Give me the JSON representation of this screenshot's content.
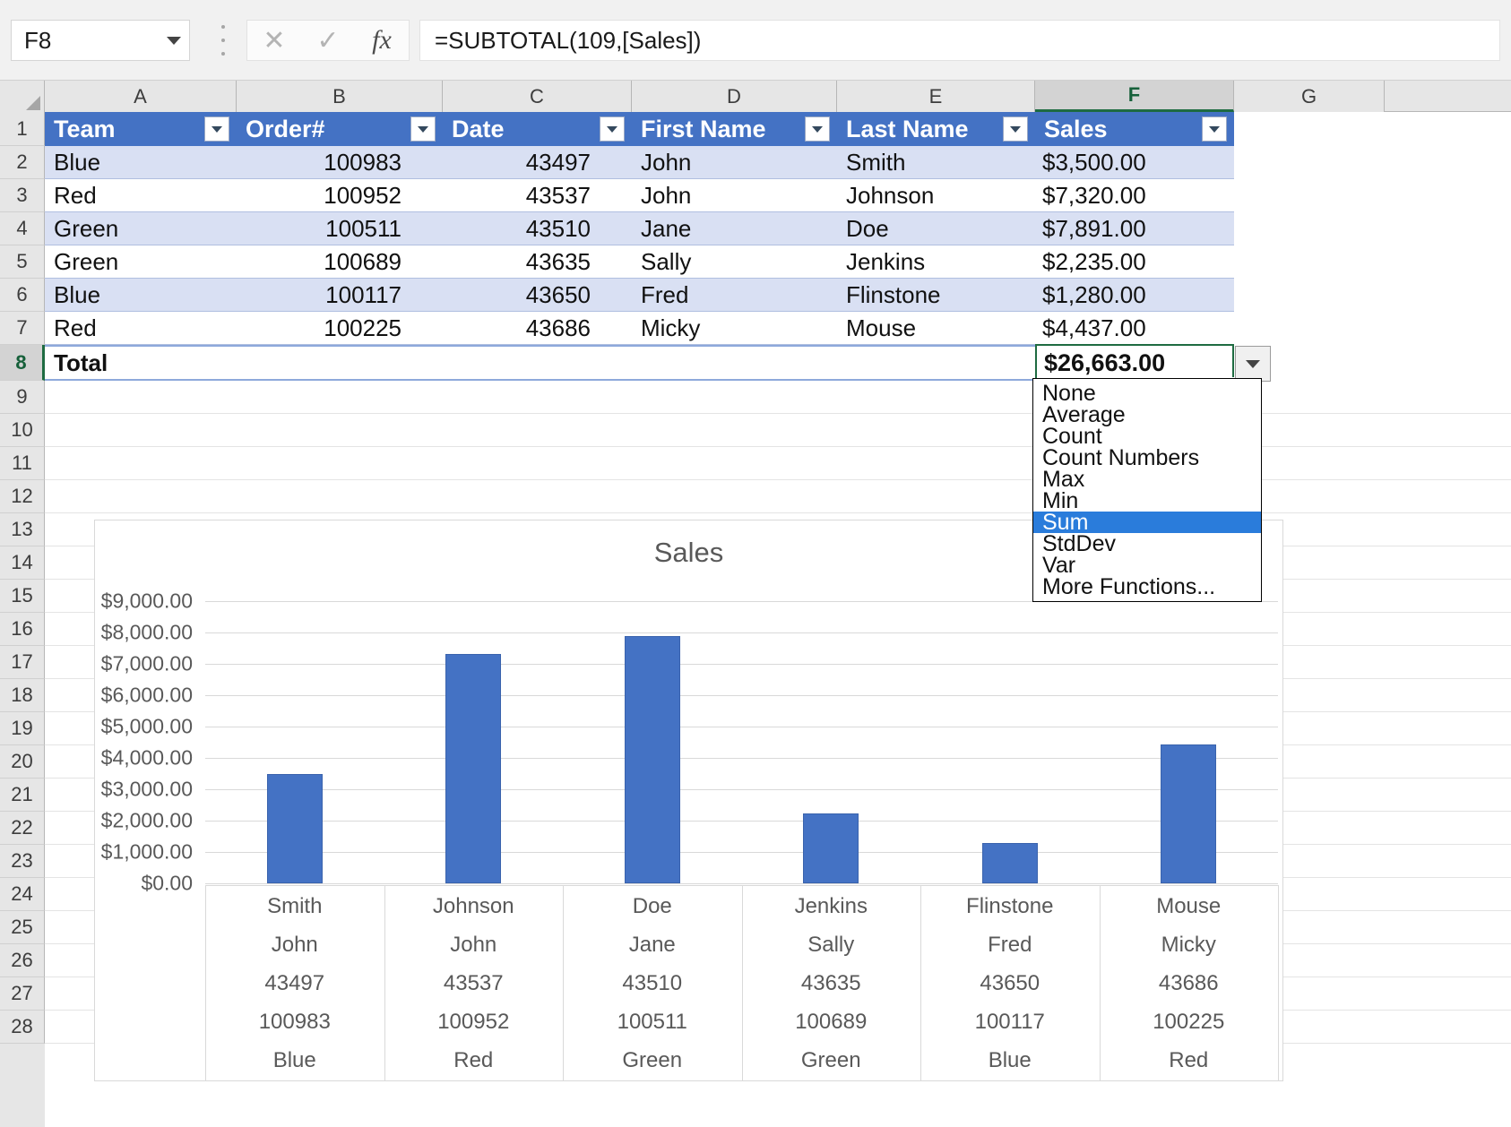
{
  "formula_bar": {
    "name_box_value": "F8",
    "formula": "=SUBTOTAL(109,[Sales])",
    "cancel_icon": "✕",
    "enter_icon": "✓",
    "function_icon": "fx"
  },
  "columns": [
    "A",
    "B",
    "C",
    "D",
    "E",
    "F",
    "G"
  ],
  "selected_column": "F",
  "selected_row": "8",
  "row_numbers": [
    "1",
    "2",
    "3",
    "4",
    "5",
    "6",
    "7",
    "8",
    "9",
    "10",
    "11",
    "12",
    "13",
    "14",
    "15",
    "16",
    "17",
    "18",
    "19",
    "20",
    "21",
    "22",
    "23",
    "24",
    "25",
    "26",
    "27",
    "28"
  ],
  "table": {
    "headers": [
      "Team",
      "Order#",
      "Date",
      "First Name",
      "Last Name",
      "Sales"
    ],
    "rows": [
      {
        "team": "Blue",
        "order": "100983",
        "date": "43497",
        "first": "John",
        "last": "Smith",
        "sales": "$3,500.00"
      },
      {
        "team": "Red",
        "order": "100952",
        "date": "43537",
        "first": "John",
        "last": "Johnson",
        "sales": "$7,320.00"
      },
      {
        "team": "Green",
        "order": "100511",
        "date": "43510",
        "first": "Jane",
        "last": "Doe",
        "sales": "$7,891.00"
      },
      {
        "team": "Green",
        "order": "100689",
        "date": "43635",
        "first": "Sally",
        "last": "Jenkins",
        "sales": "$2,235.00"
      },
      {
        "team": "Blue",
        "order": "100117",
        "date": "43650",
        "first": "Fred",
        "last": "Flinstone",
        "sales": "$1,280.00"
      },
      {
        "team": "Red",
        "order": "100225",
        "date": "43686",
        "first": "Micky",
        "last": "Mouse",
        "sales": "$4,437.00"
      }
    ],
    "total_label": "Total",
    "total_value": "$26,663.00",
    "header_fill": "#4472C4",
    "band_fill": "#D9E0F3"
  },
  "totals_menu": {
    "items": [
      "None",
      "Average",
      "Count",
      "Count Numbers",
      "Max",
      "Min",
      "Sum",
      "StdDev",
      "Var",
      "More Functions..."
    ],
    "selected": "Sum",
    "highlight_color": "#2A7CDB"
  },
  "chart_data": {
    "type": "bar",
    "title": "Sales",
    "xlabel": "",
    "ylabel": "",
    "ylim": [
      0,
      9000
    ],
    "ytick_labels": [
      "$0.00",
      "$1,000.00",
      "$2,000.00",
      "$3,000.00",
      "$4,000.00",
      "$5,000.00",
      "$6,000.00",
      "$7,000.00",
      "$8,000.00",
      "$9,000.00"
    ],
    "ytick_values": [
      0,
      1000,
      2000,
      3000,
      4000,
      5000,
      6000,
      7000,
      8000,
      9000
    ],
    "grid": true,
    "legend": false,
    "bar_color": "#4472C4",
    "categories": [
      {
        "last": "Smith",
        "first": "John",
        "date": "43497",
        "order": "100983",
        "team": "Blue"
      },
      {
        "last": "Johnson",
        "first": "John",
        "date": "43537",
        "order": "100952",
        "team": "Red"
      },
      {
        "last": "Doe",
        "first": "Jane",
        "date": "43510",
        "order": "100511",
        "team": "Green"
      },
      {
        "last": "Jenkins",
        "first": "Sally",
        "date": "43635",
        "order": "100689",
        "team": "Green"
      },
      {
        "last": "Flinstone",
        "first": "Fred",
        "date": "43650",
        "order": "100117",
        "team": "Blue"
      },
      {
        "last": "Mouse",
        "first": "Micky",
        "date": "43686",
        "order": "100225",
        "team": "Red"
      }
    ],
    "values": [
      3500,
      7320,
      7891,
      2235,
      1280,
      4437
    ]
  }
}
